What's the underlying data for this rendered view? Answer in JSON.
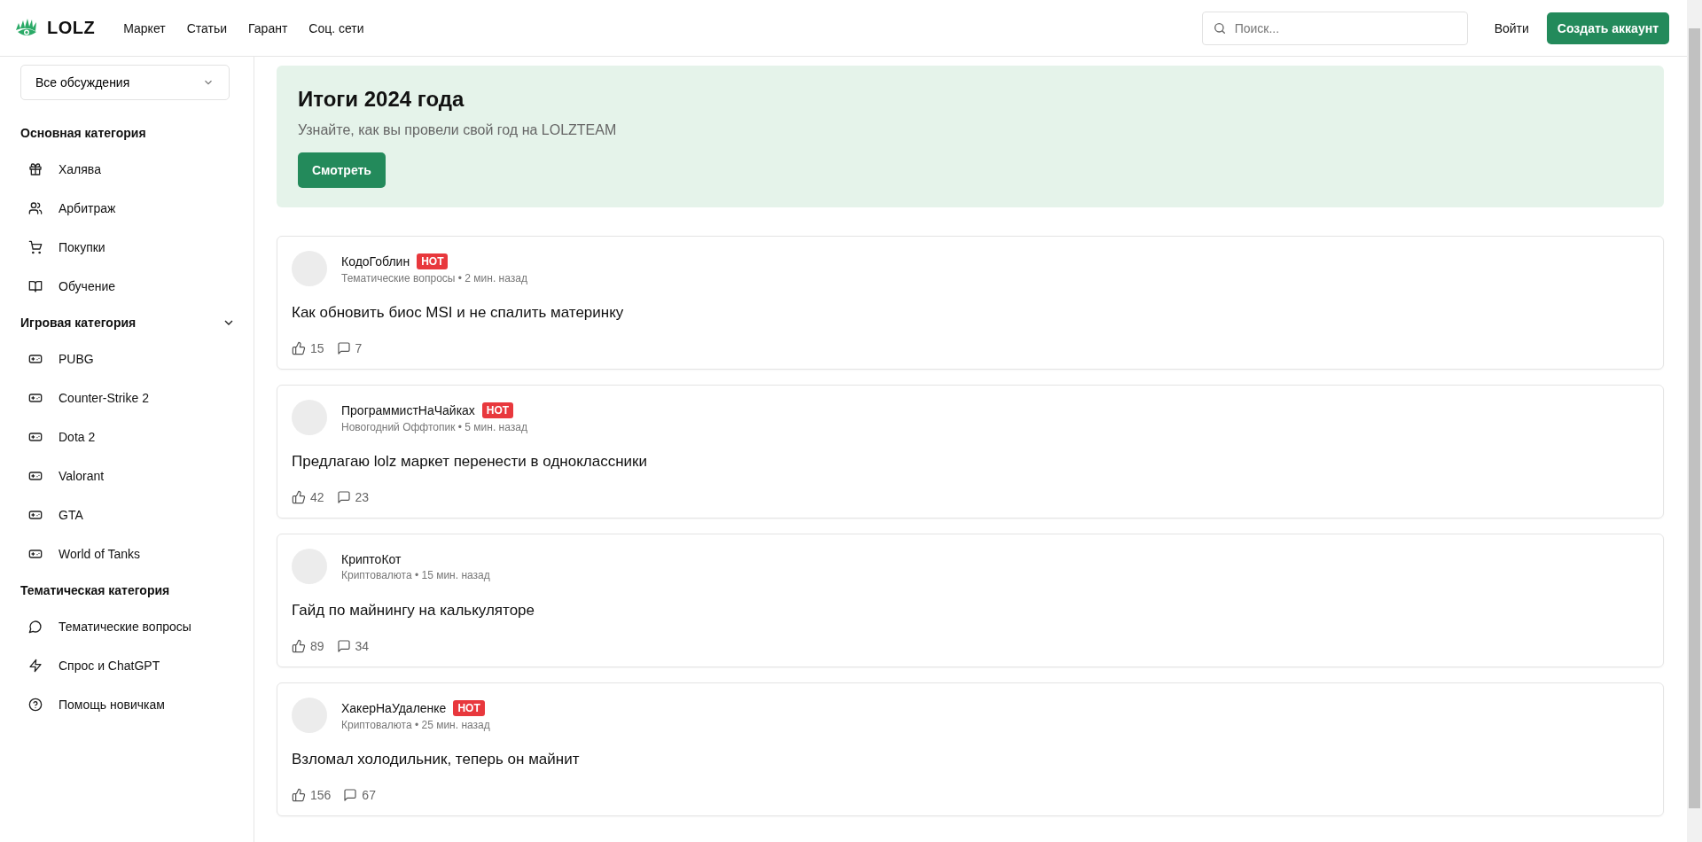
{
  "header": {
    "logo": "LOLZ",
    "nav": [
      "Маркет",
      "Статьи",
      "Гарант",
      "Соц. сети"
    ],
    "search": {
      "placeholder": "Поиск..."
    },
    "login": "Войти",
    "signup": "Создать аккаунт"
  },
  "sidebar": {
    "filter": "Все обсуждения",
    "sections": [
      {
        "title": "Основная категория",
        "collapsible": false,
        "items": [
          "Халява",
          "Арбитраж",
          "Покупки",
          "Обучение"
        ]
      },
      {
        "title": "Игровая категория",
        "collapsible": true,
        "expanded": true,
        "items": [
          "PUBG",
          "Counter-Strike 2",
          "Dota 2",
          "Valorant",
          "GTA",
          "World of Tanks"
        ]
      },
      {
        "title": "Тематическая категория",
        "collapsible": false,
        "items": [
          "Тематические вопросы",
          "Спрос и ChatGPT",
          "Помощь новичкам"
        ]
      }
    ]
  },
  "banner": {
    "title": "Итоги 2024 года",
    "subtitle": "Узнайте, как вы провели свой год на LOLZTEAM",
    "button": "Смотреть"
  },
  "posts": [
    {
      "author": "КодоГоблин",
      "hot": true,
      "hot_label": "HOT",
      "meta": "Тематические вопросы • 2 мин. назад",
      "title": "Как обновить биос MSI и не спалить материнку",
      "likes": "15",
      "comments": "7"
    },
    {
      "author": "ПрограммистНаЧайках",
      "hot": true,
      "hot_label": "HOT",
      "meta": "Новогодний Оффтопик • 5 мин. назад",
      "title": "Предлагаю lolz маркет перенести в одноклассники",
      "likes": "42",
      "comments": "23"
    },
    {
      "author": "КриптоКот",
      "hot": false,
      "meta": "Криптовалюта • 15 мин. назад",
      "title": "Гайд по майнингу на калькуляторе",
      "likes": "89",
      "comments": "34"
    },
    {
      "author": "ХакерНаУдаленке",
      "hot": true,
      "hot_label": "HOT",
      "meta": "Криптовалюта • 25 мин. назад",
      "title": "Взломал холодильник, теперь он майнит",
      "likes": "156",
      "comments": "67"
    }
  ]
}
